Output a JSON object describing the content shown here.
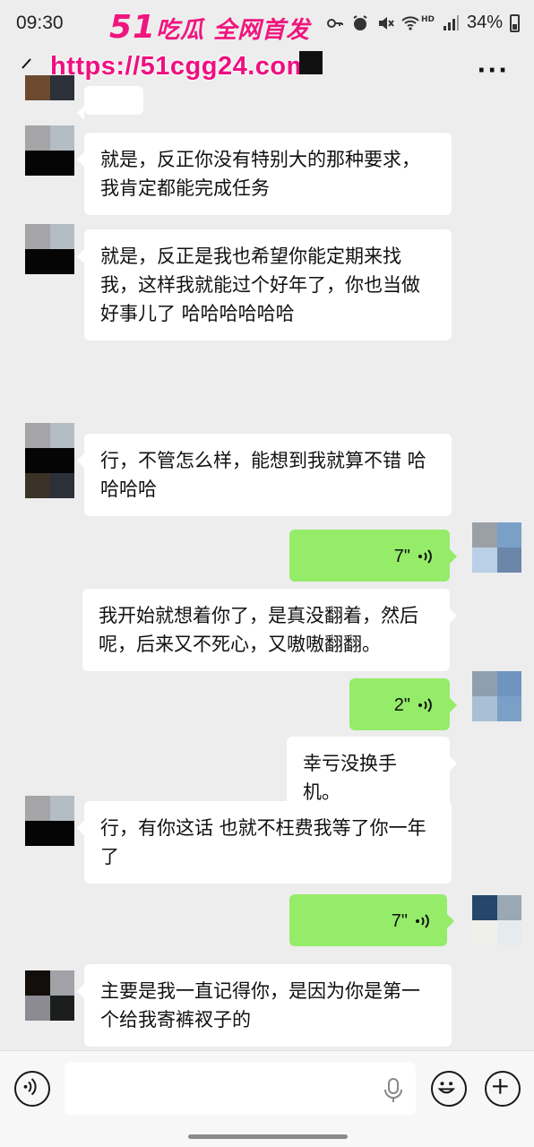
{
  "status_bar": {
    "time": "09:30",
    "hd_label": "HD",
    "battery": "34%",
    "icons": [
      "key-icon",
      "alarm-icon",
      "mute-icon",
      "wifi-icon",
      "signal-icon",
      "battery-icon"
    ]
  },
  "watermark": {
    "title_num": "51",
    "title_text": "吃瓜 全网首发",
    "url": "https://51cgg24.com",
    "color": "#ef0f80"
  },
  "nav": {
    "more": "···"
  },
  "messages": [
    {
      "side": "in",
      "text": "就是，反正你没有特别大的那种要求，我肯定都能完成任务"
    },
    {
      "side": "in",
      "text": "就是，反正是我也希望你能定期来找我，这样我就能过个好年了，你也当做好事儿了 哈哈哈哈哈哈"
    },
    {
      "side": "in",
      "text": "行，不管怎么样，能想到我就算不错 哈哈哈哈"
    },
    {
      "side": "out",
      "type": "voice",
      "duration": "7\""
    },
    {
      "side": "out",
      "text": "我开始就想着你了，是真没翻着，然后呢，后来又不死心，又嗷嗷翻翻。"
    },
    {
      "side": "out",
      "type": "voice",
      "duration": "2\""
    },
    {
      "side": "out",
      "text": "幸亏没换手机。"
    },
    {
      "side": "in",
      "text": "行，有你这话 也就不枉费我等了你一年了"
    },
    {
      "side": "out",
      "type": "voice",
      "duration": "7\""
    },
    {
      "side": "in",
      "text": "主要是我一直记得你，是因为你是第一个给我寄裤衩子的"
    }
  ],
  "colors": {
    "background": "#ededed",
    "out_bubble": "#95ec69",
    "in_bubble": "#ffffff"
  },
  "input": {
    "value": ""
  }
}
